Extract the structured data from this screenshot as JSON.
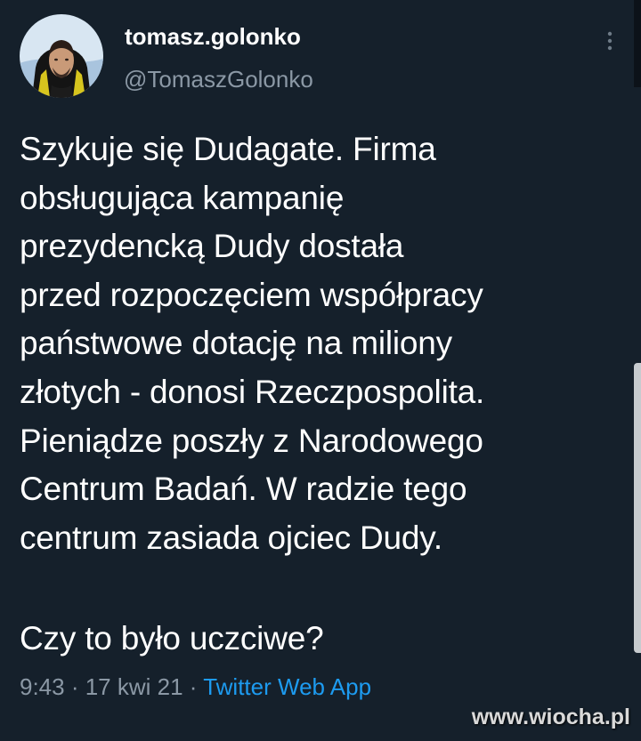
{
  "tweet": {
    "author": {
      "display_name": "tomasz.golonko",
      "handle": "@TomaszGolonko"
    },
    "text": "Szykuje się Dudagate. Firma\nobsługująca kampanię\nprezydencką Dudy dostała\nprzed rozpoczęciem współpracy\npaństwowe dotację na miliony\nzłotych - donosi Rzeczpospolita.\nPieniądze poszły z Narodowego\nCentrum Badań. W radzie tego\ncentrum zasiada ojciec Dudy.",
    "question": "Czy to było uczciwe?",
    "time": "9:43",
    "separator": " · ",
    "date": "17 kwi 21",
    "source": "Twitter Web App"
  },
  "icons": {
    "more": "more-vertical-icon",
    "avatar": "profile-photo"
  },
  "watermark": "www.wiocha.pl",
  "colors": {
    "background": "#15202b",
    "text": "#ffffff",
    "secondary": "#8b98a5",
    "link": "#1d9bf0"
  }
}
